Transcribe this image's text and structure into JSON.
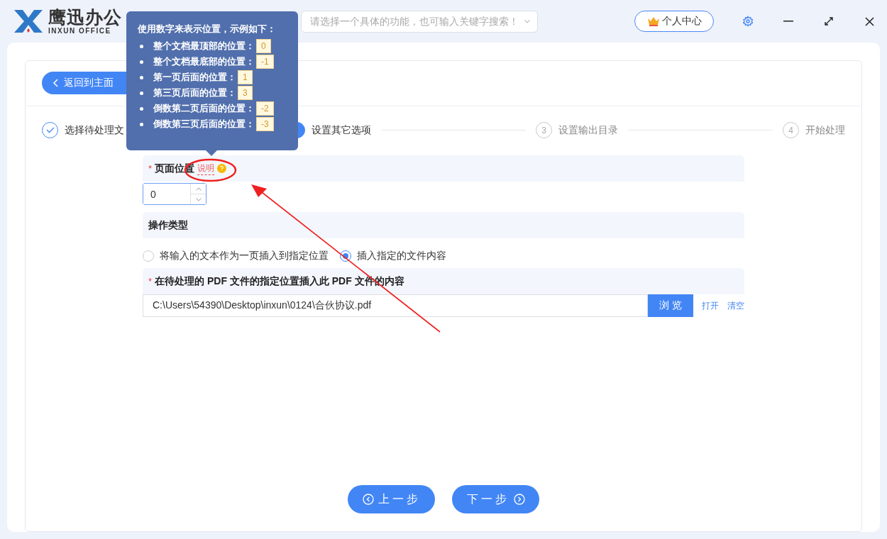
{
  "app": {
    "logo_text": "鹰迅办公",
    "logo_subtext": "INXUN OFFICE"
  },
  "search": {
    "placeholder": "请选择一个具体的功能，也可输入关键字搜索！"
  },
  "user_button": "个人中心",
  "back_button": "返回到主面",
  "steps": [
    {
      "label": "选择待处理文",
      "done": true,
      "active": false
    },
    {
      "label": "设置其它选项",
      "done": false,
      "active": true
    },
    {
      "number": "3",
      "label": "设置输出目录",
      "done": false,
      "active": false
    },
    {
      "number": "4",
      "label": "开始处理",
      "done": false,
      "active": false
    }
  ],
  "page_position": {
    "required_mark": "*",
    "label": "页面位置",
    "help_link": "说明",
    "value": "0"
  },
  "operation": {
    "label": "操作类型",
    "options": [
      {
        "label": "将输入的文本作为一页插入到指定位置",
        "selected": false
      },
      {
        "label": "插入指定的文件内容",
        "selected": true
      }
    ]
  },
  "file": {
    "required_mark": "*",
    "label": "在待处理的 PDF 文件的指定位置插入此 PDF 文件的内容",
    "value": "C:\\Users\\54390\\Desktop\\inxun\\0124\\合伙协议.pdf",
    "browse_button": "浏 览",
    "links": [
      "打开",
      "清空"
    ]
  },
  "tooltip": {
    "title": "使用数字来表示位置，示例如下：",
    "items": [
      {
        "text": "整个文档最顶部的位置：",
        "value": "0"
      },
      {
        "text": "整个文档最底部的位置：",
        "value": "-1"
      },
      {
        "text": "第一页后面的位置：",
        "value": "1"
      },
      {
        "text": "第三页后面的位置：",
        "value": "3"
      },
      {
        "text": "倒数第二页后面的位置：",
        "value": "-2"
      },
      {
        "text": "倒数第三页后面的位置：",
        "value": "-3"
      }
    ]
  },
  "nav": {
    "prev": "上一步",
    "next": "下一步"
  }
}
